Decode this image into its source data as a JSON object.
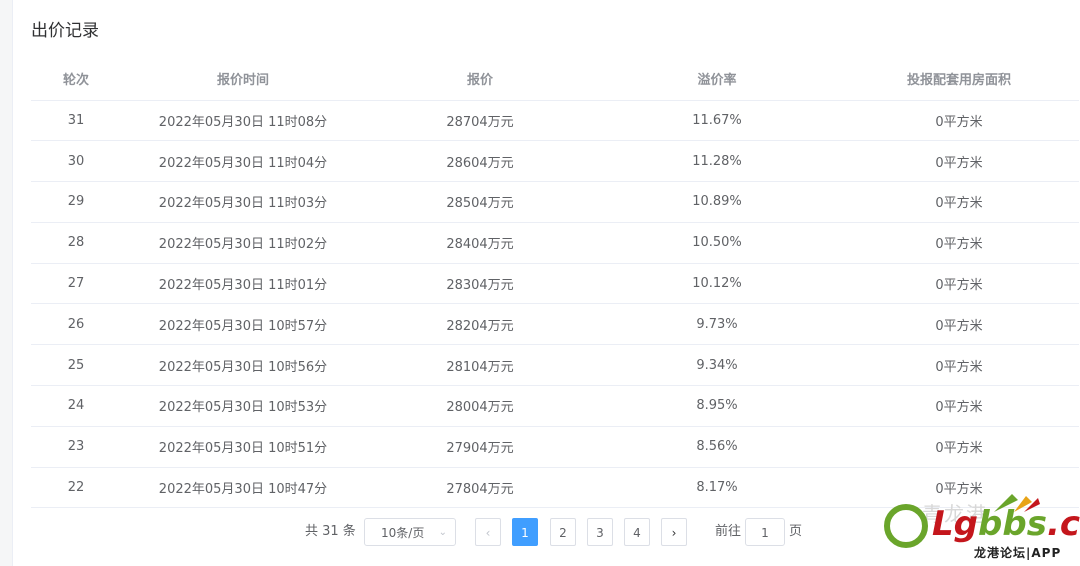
{
  "title": "出价记录",
  "table": {
    "headers": [
      "轮次",
      "报价时间",
      "报价",
      "溢价率",
      "投报配套用房面积"
    ],
    "rows": [
      [
        "31",
        "2022年05月30日 11时08分",
        "28704万元",
        "11.67%",
        "0平方米"
      ],
      [
        "30",
        "2022年05月30日 11时04分",
        "28604万元",
        "11.28%",
        "0平方米"
      ],
      [
        "29",
        "2022年05月30日 11时03分",
        "28504万元",
        "10.89%",
        "0平方米"
      ],
      [
        "28",
        "2022年05月30日 11时02分",
        "28404万元",
        "10.50%",
        "0平方米"
      ],
      [
        "27",
        "2022年05月30日 11时01分",
        "28304万元",
        "10.12%",
        "0平方米"
      ],
      [
        "26",
        "2022年05月30日 10时57分",
        "28204万元",
        "9.73%",
        "0平方米"
      ],
      [
        "25",
        "2022年05月30日 10时56分",
        "28104万元",
        "9.34%",
        "0平方米"
      ],
      [
        "24",
        "2022年05月30日 10时53分",
        "28004万元",
        "8.95%",
        "0平方米"
      ],
      [
        "23",
        "2022年05月30日 10时51分",
        "27904万元",
        "8.56%",
        "0平方米"
      ],
      [
        "22",
        "2022年05月30日 10时47分",
        "27804万元",
        "8.17%",
        "0平方米"
      ]
    ]
  },
  "pagination": {
    "total_label": "共 31 条",
    "page_size_label": "10条/页",
    "pages": [
      "1",
      "2",
      "3",
      "4"
    ],
    "current_page": "1",
    "prev_icon": "chevron-left-icon",
    "next_icon": "chevron-right-icon",
    "goto_label": "前往",
    "goto_value": "1",
    "goto_suffix": "页"
  },
  "watermark": {
    "brand_prefix": "Lg",
    "brand_main": "bbs",
    "brand_suffix": ".cn",
    "subtitle": "龙港论坛|APP",
    "faded_text": "青龙港"
  },
  "colors": {
    "accent": "#409eff",
    "brand_green": "#6aa52b",
    "brand_red": "#c4161c"
  }
}
